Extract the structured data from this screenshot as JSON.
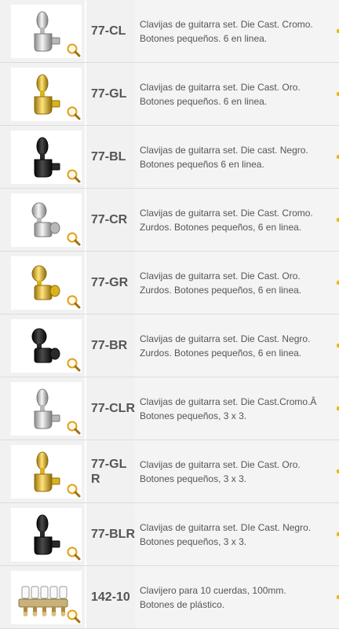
{
  "products": [
    {
      "code": "77-CL",
      "finish": "chrome",
      "style": "side",
      "desc1": "Clavijas de guitarra set. Die Cast. Cromo.",
      "desc2": "Botones pequeños. 6 en linea."
    },
    {
      "code": "77-GL",
      "finish": "gold",
      "style": "side",
      "desc1": "Clavijas de guitarra set. Die Cast. Oro.",
      "desc2": "Botones pequeños. 6 en linea."
    },
    {
      "code": "77-BL",
      "finish": "black",
      "style": "side",
      "desc1": "Clavijas de guitarra set. Die cast. Negro.",
      "desc2": "Botones pequeños 6 en linea."
    },
    {
      "code": "77-CR",
      "finish": "chrome",
      "style": "front",
      "desc1": "Clavijas de guitarra set. Die Cast. Cromo.",
      "desc2": "Zurdos. Botones pequeños, 6 en linea."
    },
    {
      "code": "77-GR",
      "finish": "gold",
      "style": "front",
      "desc1": "Clavijas de guitarra set. Die Cast. Oro.",
      "desc2": "Zurdos. Botones pequeños, 6 en linea."
    },
    {
      "code": "77-BR",
      "finish": "black",
      "style": "front",
      "desc1": "Clavijas de guitarra set. Die Cast. Negro.",
      "desc2": "Zurdos. Botones pequeños, 6 en linea."
    },
    {
      "code": "77-CLR",
      "finish": "chrome",
      "style": "side",
      "desc1": "Clavijas de guitarra set. Die Cast.Cromo.Â",
      "desc2": "Botones pequeños, 3 x 3."
    },
    {
      "code": "77-GLR",
      "finish": "gold",
      "style": "side",
      "desc1": "Clavijas de guitarra set. Die Cast. Oro.",
      "desc2": "Botones pequeños, 3 x 3."
    },
    {
      "code": "77-BLR",
      "finish": "black",
      "style": "side",
      "desc1": "Clavijas de guitarra set. DIe Cast. Negro.",
      "desc2": "Botones pequeños, 3 x 3."
    },
    {
      "code": "142-10",
      "finish": "multi",
      "style": "strip",
      "desc1": "Clavijero para 10 cuerdas, 100mm.",
      "desc2": "Botones de plástico."
    }
  ],
  "icons": {
    "thumbnail": "tuning-peg-icon",
    "zoom": "magnifier-zoom-icon"
  },
  "colors": {
    "text": "#555555",
    "divider": "#dcdcdc",
    "cell_bg": "#f1f1f1",
    "accent": "#f0b400",
    "zoom_ring": "#e0a020"
  }
}
